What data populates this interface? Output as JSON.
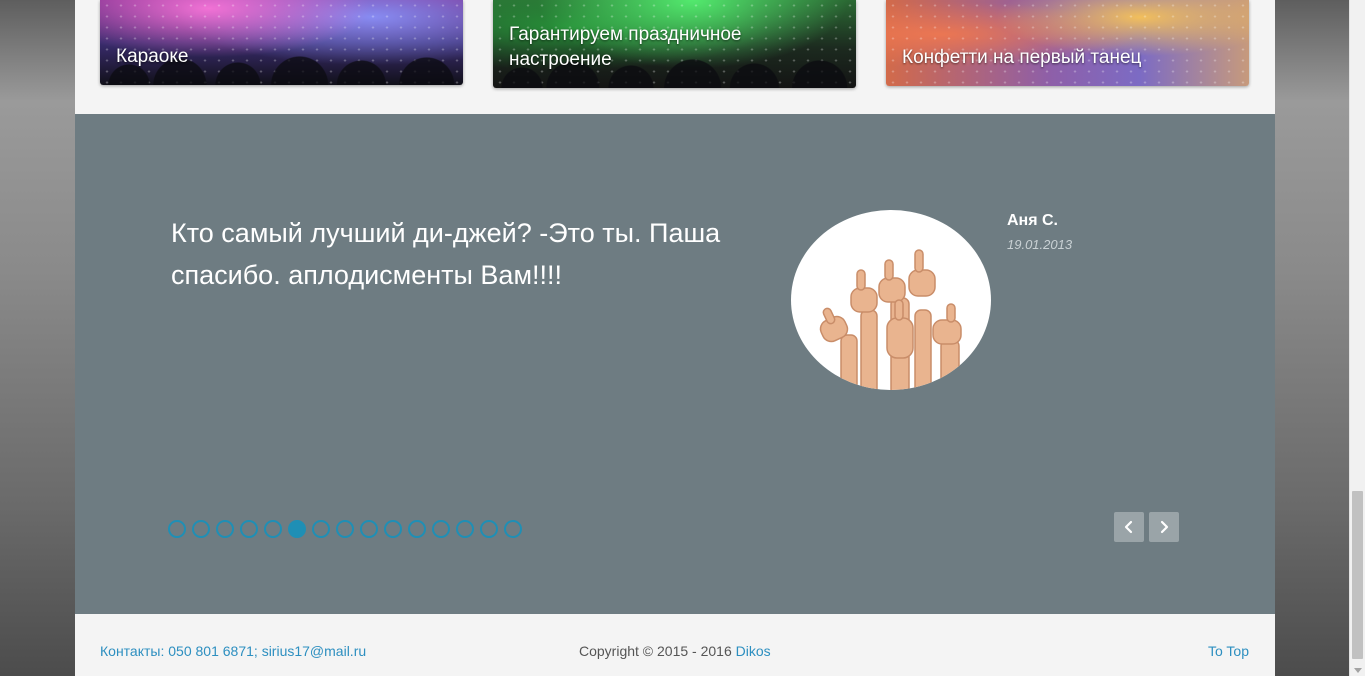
{
  "cards": [
    {
      "title": "Караоке",
      "image": "crowd-concert-image"
    },
    {
      "title": "Гарантируем праздничное настроение",
      "image": "laser-party-image"
    },
    {
      "title": "Конфетти на первый танец",
      "image": "confetti-image"
    }
  ],
  "testimonial": {
    "quote": "Кто самый лучший ди-джей? -Это ты. Паша спасибо. аплодисменты Вам!!!!",
    "author": "Аня С.",
    "date": "19.01.2013",
    "avatar": "thumbs-up-hands-image",
    "pager": {
      "total": 15,
      "active_index": 5
    },
    "prev_icon": "chevron-left-icon",
    "next_icon": "chevron-right-icon"
  },
  "footer": {
    "contacts_label": "Контакты:",
    "phone": "050 801 6871",
    "separator": ";",
    "email": "sirius17@mail.ru",
    "copyright": "Copyright © 2015 - 2016",
    "brand": "Dikos",
    "to_top": "To Top"
  },
  "colors": {
    "testimonial_bg": "#6e7c82",
    "accent": "#1f8fb5",
    "link": "#2d8fc0",
    "page_bg": "#f4f4f4"
  }
}
